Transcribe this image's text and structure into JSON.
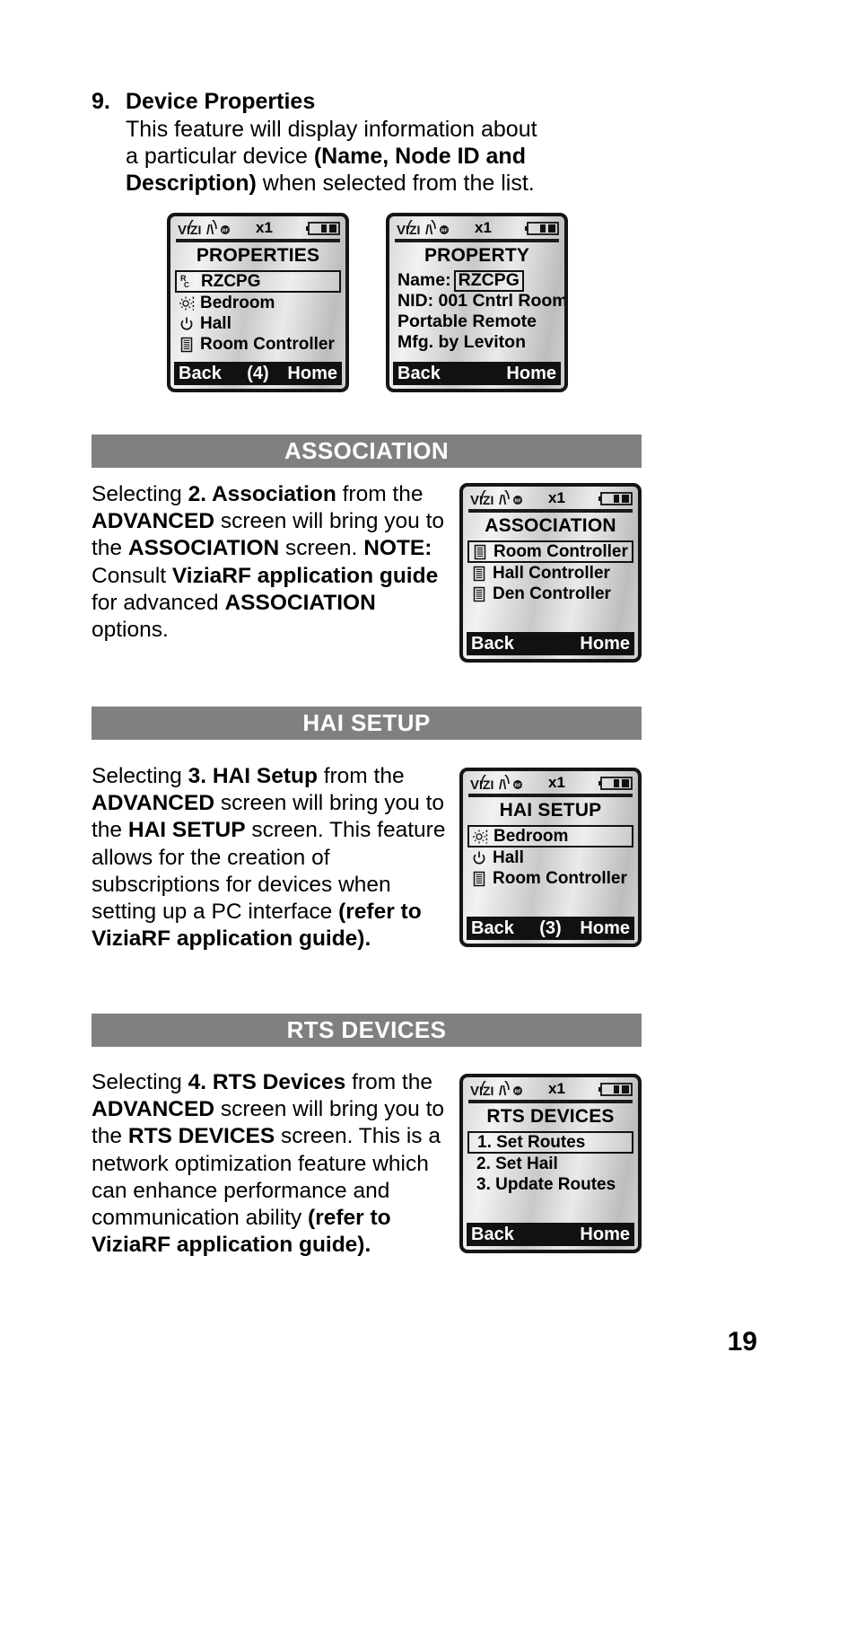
{
  "page": {
    "number": "19"
  },
  "intro": {
    "number": "9.",
    "title": "Device Properties",
    "line1": "This feature will display information about",
    "line2_a": "a particular device ",
    "line2_b": "(Name, Node ID and",
    "line3_b": "Description)",
    "line3_a": " when selected from the list."
  },
  "screens": {
    "properties": {
      "logo": "VIZIA RF",
      "multiplier": "x1",
      "battery_icon": "battery-full-icon",
      "title": "PROPERTIES",
      "items": [
        {
          "icon": "remote-control-icon",
          "label": "RZCPG",
          "selected": true
        },
        {
          "icon": "dimmer-brightness-icon",
          "label": "Bedroom",
          "selected": false
        },
        {
          "icon": "power-switch-icon",
          "label": "Hall",
          "selected": false
        },
        {
          "icon": "room-controller-icon",
          "label": "Room Controller",
          "selected": false
        }
      ],
      "footer": {
        "left": "Back",
        "middle": "(4)",
        "right": "Home"
      }
    },
    "property": {
      "logo": "VIZIA RF",
      "multiplier": "x1",
      "battery_icon": "battery-full-icon",
      "title": "PROPERTY",
      "rows": [
        {
          "label": "Name:",
          "value": "RZCPG",
          "boxed": true
        },
        {
          "label": "NID: 001 Cntrl Room",
          "value": "",
          "boxed": false
        },
        {
          "label": "Portable Remote",
          "value": "",
          "boxed": false
        },
        {
          "label": "Mfg. by Leviton",
          "value": "",
          "boxed": false
        }
      ],
      "footer": {
        "left": "Back",
        "middle": "",
        "right": "Home"
      }
    },
    "association": {
      "logo": "VIZIA RF",
      "multiplier": "x1",
      "battery_icon": "battery-full-icon",
      "title": "ASSOCIATION",
      "items": [
        {
          "icon": "room-controller-icon",
          "label": "Room Controller",
          "selected": true
        },
        {
          "icon": "room-controller-icon",
          "label": "Hall Controller",
          "selected": false
        },
        {
          "icon": "room-controller-icon",
          "label": "Den Controller",
          "selected": false
        }
      ],
      "footer": {
        "left": "Back",
        "middle": "",
        "right": "Home"
      }
    },
    "hai_setup": {
      "logo": "VIZIA RF",
      "multiplier": "x1",
      "battery_icon": "battery-full-icon",
      "title": "HAI SETUP",
      "items": [
        {
          "icon": "dimmer-brightness-icon",
          "label": "Bedroom",
          "selected": true
        },
        {
          "icon": "power-switch-icon",
          "label": "Hall",
          "selected": false
        },
        {
          "icon": "room-controller-icon",
          "label": "Room Controller",
          "selected": false
        }
      ],
      "footer": {
        "left": "Back",
        "middle": "(3)",
        "right": "Home"
      }
    },
    "rts_devices": {
      "logo": "VIZIA RF",
      "multiplier": "x1",
      "battery_icon": "battery-full-icon",
      "title": "RTS DEVICES",
      "items": [
        {
          "icon": "",
          "label": "1. Set Routes",
          "selected": true
        },
        {
          "icon": "",
          "label": "2. Set Hail",
          "selected": false
        },
        {
          "icon": "",
          "label": "3. Update Routes",
          "selected": false
        }
      ],
      "footer": {
        "left": "Back",
        "middle": "",
        "right": "Home"
      }
    }
  },
  "sections": [
    {
      "id": "association",
      "header": "ASSOCIATION",
      "paragraph": {
        "p1": "Selecting ",
        "b1": "2. Association",
        "p2": " from the ",
        "b2": "ADVANCED",
        "p3": " screen will bring you to the ",
        "b3": "ASSOCIATION",
        "p4": " screen. ",
        "b4": "NOTE:",
        "p5": " Consult ",
        "b5": "ViziaRF application guide",
        "p6": " for advanced ",
        "b6": "ASSOCIATION",
        "p7": " options."
      }
    },
    {
      "id": "hai-setup",
      "header": "HAI SETUP",
      "paragraph": {
        "p1": "Selecting ",
        "b1": "3. HAI Setup",
        "p2": " from the ",
        "b2": "ADVANCED",
        "p3": " screen will bring you to the ",
        "b3": "HAI SETUP",
        "p4": " screen. This feature allows for the creation of subscriptions for devices when setting up a PC interface ",
        "b4": "(refer to ViziaRF application guide).",
        "p5": ""
      }
    },
    {
      "id": "rts-devices",
      "header": "RTS DEVICES",
      "paragraph": {
        "p1": "Selecting ",
        "b1": "4. RTS Devices",
        "p2": " from the ",
        "b2": "ADVANCED",
        "p3": " screen will bring you to the ",
        "b3": "RTS DEVICES",
        "p4": " screen. This is a network optimization feature which can enhance performance and communication ability ",
        "b4": "(refer to ViziaRF application guide).",
        "p5": ""
      }
    }
  ],
  "colors": {
    "section_bar_bg": "#808080",
    "section_bar_text": "#ffffff",
    "device_border": "#151515",
    "device_footer_bg": "#111111",
    "text": "#000000"
  }
}
